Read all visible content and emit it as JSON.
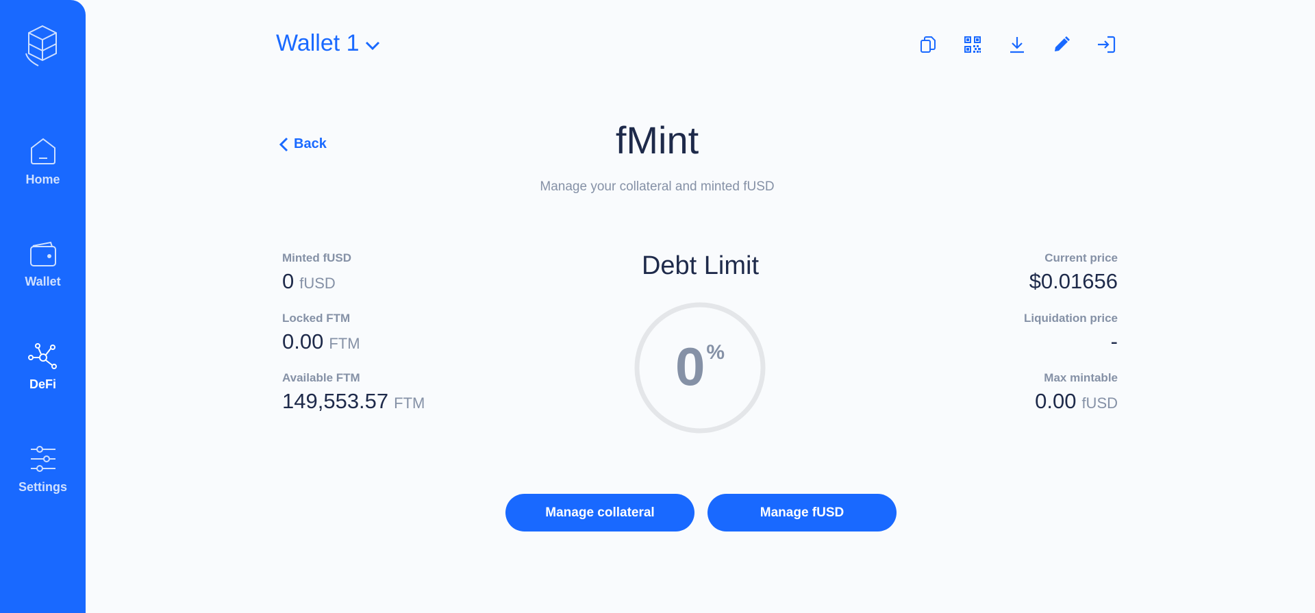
{
  "sidebar": {
    "logo_icon": "fantom-logo-icon",
    "items": [
      {
        "label": "Home",
        "icon": "home-icon"
      },
      {
        "label": "Wallet",
        "icon": "wallet-icon"
      },
      {
        "label": "DeFi",
        "icon": "defi-network-icon",
        "active": true
      },
      {
        "label": "Settings",
        "icon": "sliders-icon"
      }
    ]
  },
  "header": {
    "wallet_name": "Wallet 1",
    "tools": [
      "copy-icon",
      "qr-code-icon",
      "download-icon",
      "edit-pencil-icon",
      "logout-icon"
    ]
  },
  "page": {
    "back_label": "Back",
    "title": "fMint",
    "subtitle": "Manage your collateral and minted fUSD"
  },
  "left_stats": [
    {
      "label": "Minted fUSD",
      "value": "0",
      "unit": "fUSD"
    },
    {
      "label": "Locked FTM",
      "value": "0.00",
      "unit": "FTM"
    },
    {
      "label": "Available FTM",
      "value": "149,553.57",
      "unit": "FTM"
    }
  ],
  "right_stats": [
    {
      "label": "Current price",
      "value": "$0.01656",
      "unit": ""
    },
    {
      "label": "Liquidation price",
      "value": "-",
      "unit": ""
    },
    {
      "label": "Max mintable",
      "value": "0.00",
      "unit": "fUSD"
    }
  ],
  "debt_limit": {
    "title": "Debt Limit",
    "value": "0",
    "unit": "%",
    "fraction": 0
  },
  "buttons": {
    "manage_collateral": "Manage collateral",
    "manage_fusd": "Manage fUSD"
  },
  "colors": {
    "brand": "#1969ff",
    "text": "#1e2a4a",
    "muted": "#8591a6",
    "gauge_track": "#e4e6e9"
  }
}
